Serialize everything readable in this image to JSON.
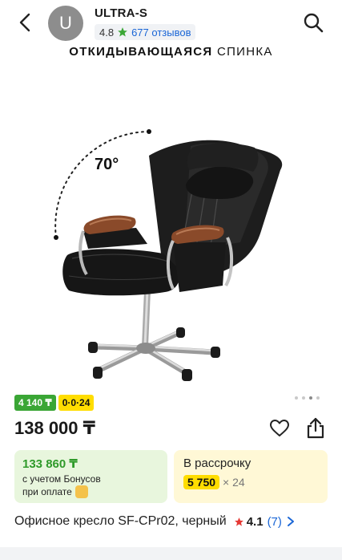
{
  "header": {
    "avatar_letter": "U",
    "seller_name": "ULTRA-S",
    "seller_rating": "4.8",
    "seller_reviews": "677 отзывов"
  },
  "image": {
    "banner_bold": "ОТКИДЫВАЮЩАЯСЯ",
    "banner_rest": " СПИНКА",
    "angle_label": "70°",
    "carousel": {
      "total": 4,
      "active": 3
    }
  },
  "badges": {
    "bonus": "4 140 ₸",
    "installment": "0·0·24"
  },
  "price": "138 000 ₸",
  "bonus_card": {
    "price": "133 860 ₸",
    "line1": "с учетом Бонусов",
    "line2": "при оплате"
  },
  "installment_card": {
    "title": "В рассрочку",
    "amount": "5 750",
    "months": "× 24"
  },
  "product": {
    "title": "Офисное кресло SF-CPr02, черный",
    "rating": "4.1",
    "reviews": "(7)"
  },
  "colors": {
    "star": "#ffb800",
    "rating_star": "#e53935",
    "link": "#1a66d6",
    "green_badge": "#3aa635",
    "yellow_badge": "#ffdd00"
  }
}
